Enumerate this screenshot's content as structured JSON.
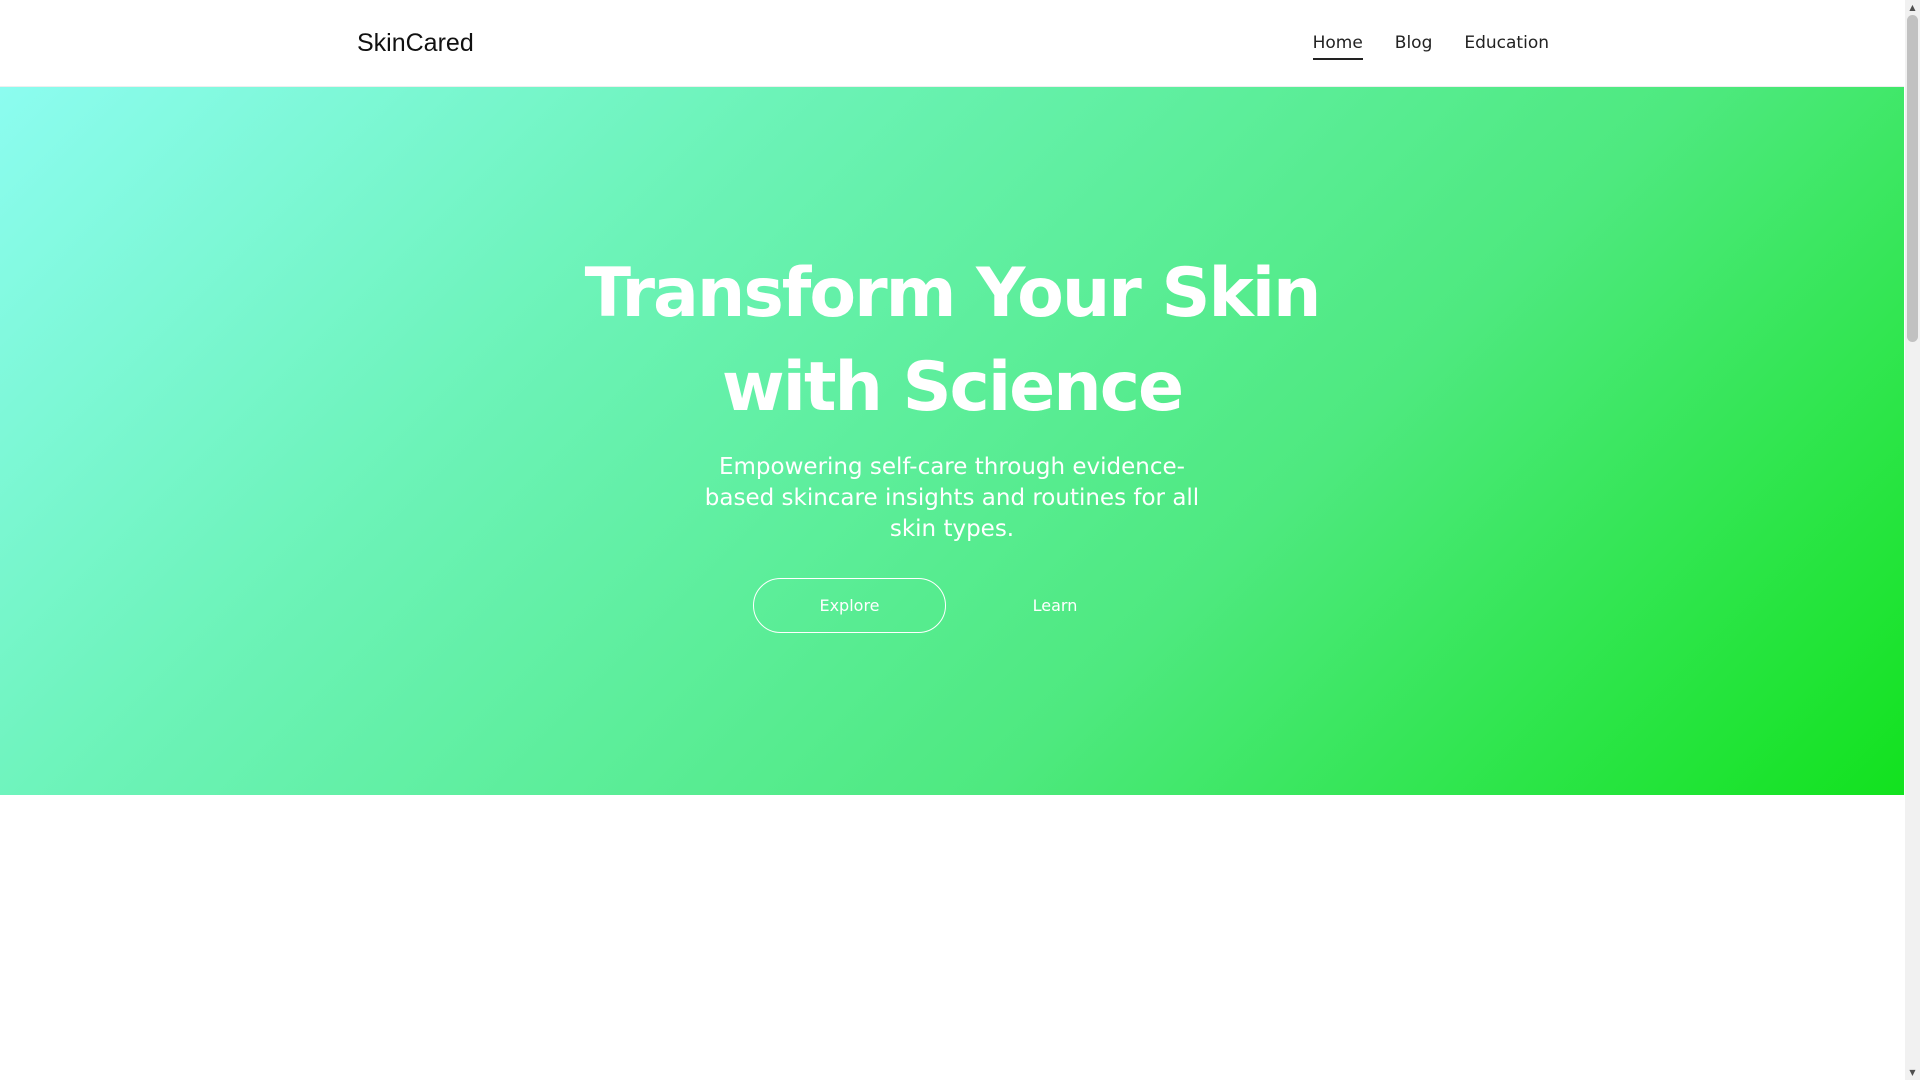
{
  "header": {
    "brand": "SkinCared",
    "nav": [
      {
        "label": "Home",
        "active": true
      },
      {
        "label": "Blog",
        "active": false
      },
      {
        "label": "Education",
        "active": false
      }
    ]
  },
  "hero": {
    "title_line1": "Transform Your Skin",
    "title_line2": "with Science",
    "subtitle": "Empowering self-care through evidence-based skincare insights and routines for all skin types.",
    "primary_button": "Explore",
    "secondary_button": "Learn",
    "gradient_colors": [
      "#8cfcf0",
      "#6cf3b8",
      "#4ee97f",
      "#12e21e"
    ]
  },
  "scrollbar": {
    "up_icon": "chevron-up-icon",
    "down_icon": "chevron-down-icon"
  }
}
